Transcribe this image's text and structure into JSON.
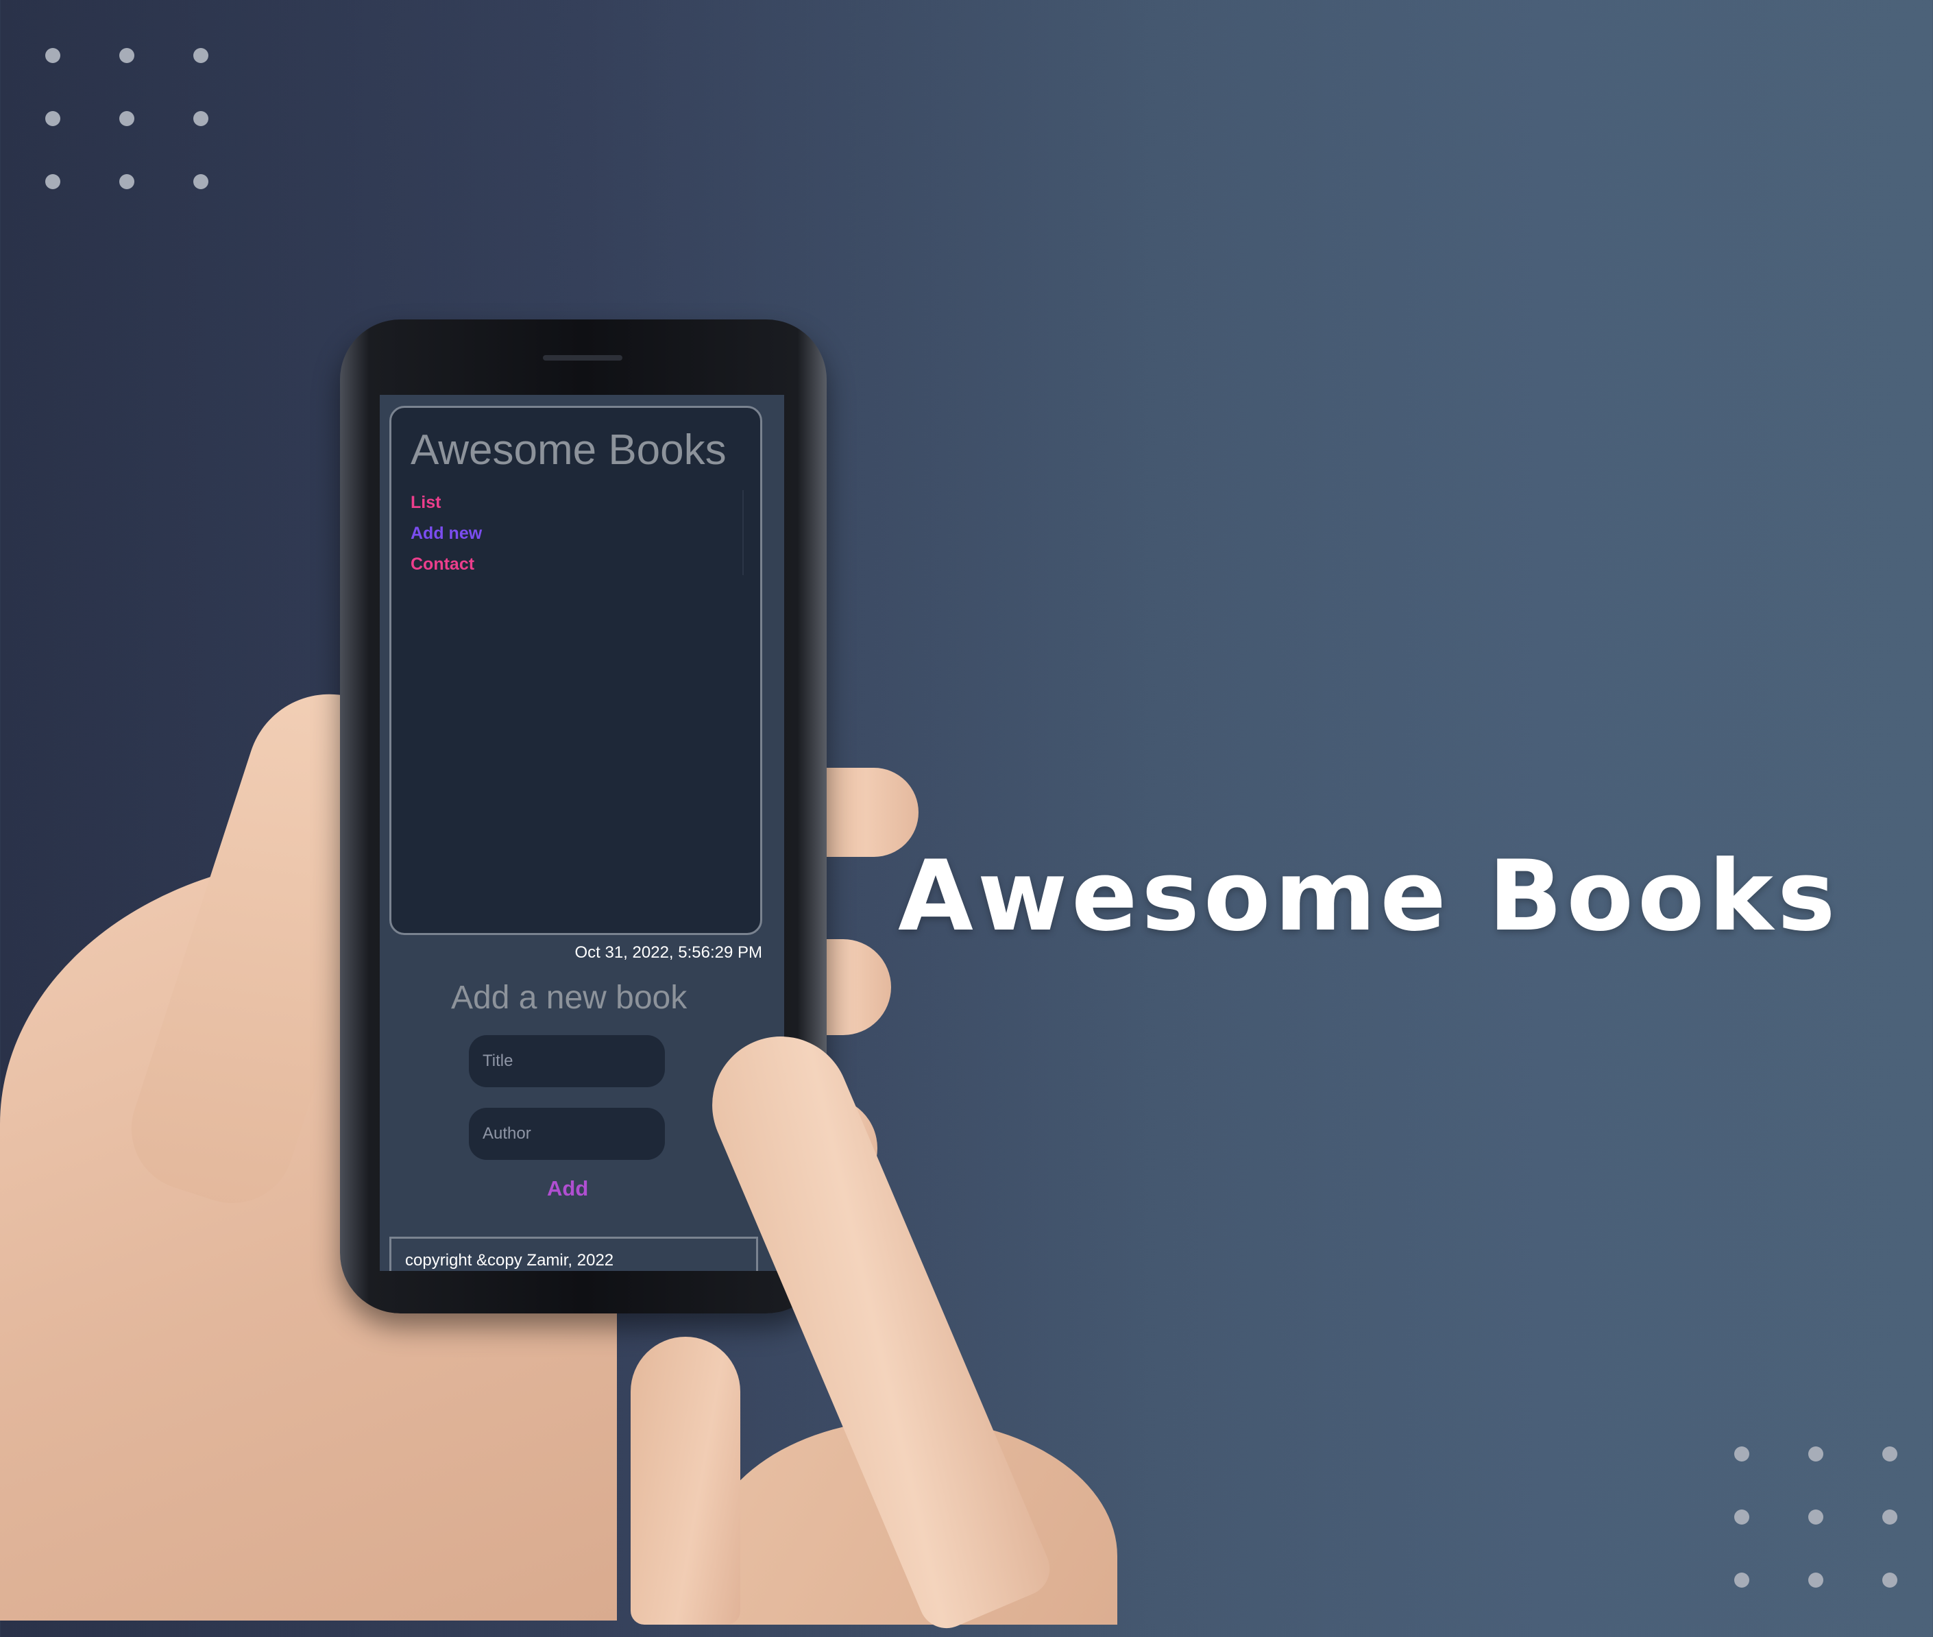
{
  "hero": {
    "title": "Awesome Books"
  },
  "app": {
    "title": "Awesome Books",
    "nav": [
      {
        "label": "List",
        "color": "#ec3e8c"
      },
      {
        "label": "Add new",
        "color": "#7b4df0"
      },
      {
        "label": "Contact",
        "color": "#ec3e8c"
      }
    ],
    "datetime": "Oct 31, 2022, 5:56:29 PM",
    "form": {
      "heading": "Add a new book",
      "title_placeholder": "Title",
      "author_placeholder": "Author",
      "add_label": "Add",
      "add_color": "#b04fd1"
    },
    "footer": {
      "text": "copyright &copy Zamir, 2022"
    }
  },
  "colors": {
    "accent_pink": "#ec3e8c",
    "accent_purple": "#7b4df0",
    "app_background": "#344154",
    "card_background": "#1e2838"
  }
}
